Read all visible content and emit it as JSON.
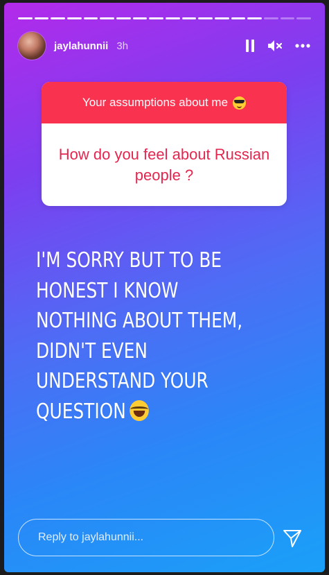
{
  "story": {
    "segments_total": 18,
    "segments_done": 15,
    "username": "jaylahunnii",
    "time_ago": "3h",
    "icons": {
      "avatar": "avatar",
      "pause": "pause-icon",
      "mute": "mute-icon",
      "more": "more-icon",
      "send": "send-icon"
    }
  },
  "question": {
    "title": "Your assumptions about me",
    "title_emoji": "sunglasses-emoji-icon",
    "text": "How do you feel about Russian people ?"
  },
  "answer": {
    "lines": [
      "I'M SORRY BUT TO BE",
      "HONEST I KNOW",
      "NOTHING ABOUT THEM,",
      "DIDN'T EVEN",
      "UNDERSTAND YOUR",
      "QUESTION"
    ],
    "trailing_emoji": "tears-of-joy-emoji-icon"
  },
  "reply": {
    "placeholder": "Reply to jaylahunnii..."
  },
  "colors": {
    "gradient_start": "#b32aea",
    "gradient_end": "#1aa0f8",
    "sticker_header": "#f8324f",
    "question_text": "#e2264f"
  }
}
